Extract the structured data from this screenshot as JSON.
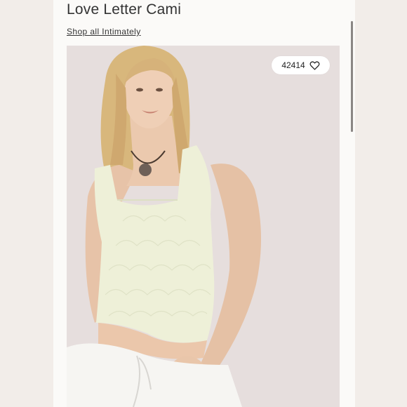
{
  "product": {
    "title": "Love Letter Cami",
    "shop_link": "Shop all Intimately"
  },
  "favorite": {
    "count": "42414",
    "icon": "heart-outline-icon"
  },
  "image": {
    "subject": "model-photo"
  },
  "colors": {
    "background": "#f4efec",
    "panel": "#fbfaf8",
    "photo_backdrop": "#e6dedd",
    "cami": "#eef0d8"
  }
}
